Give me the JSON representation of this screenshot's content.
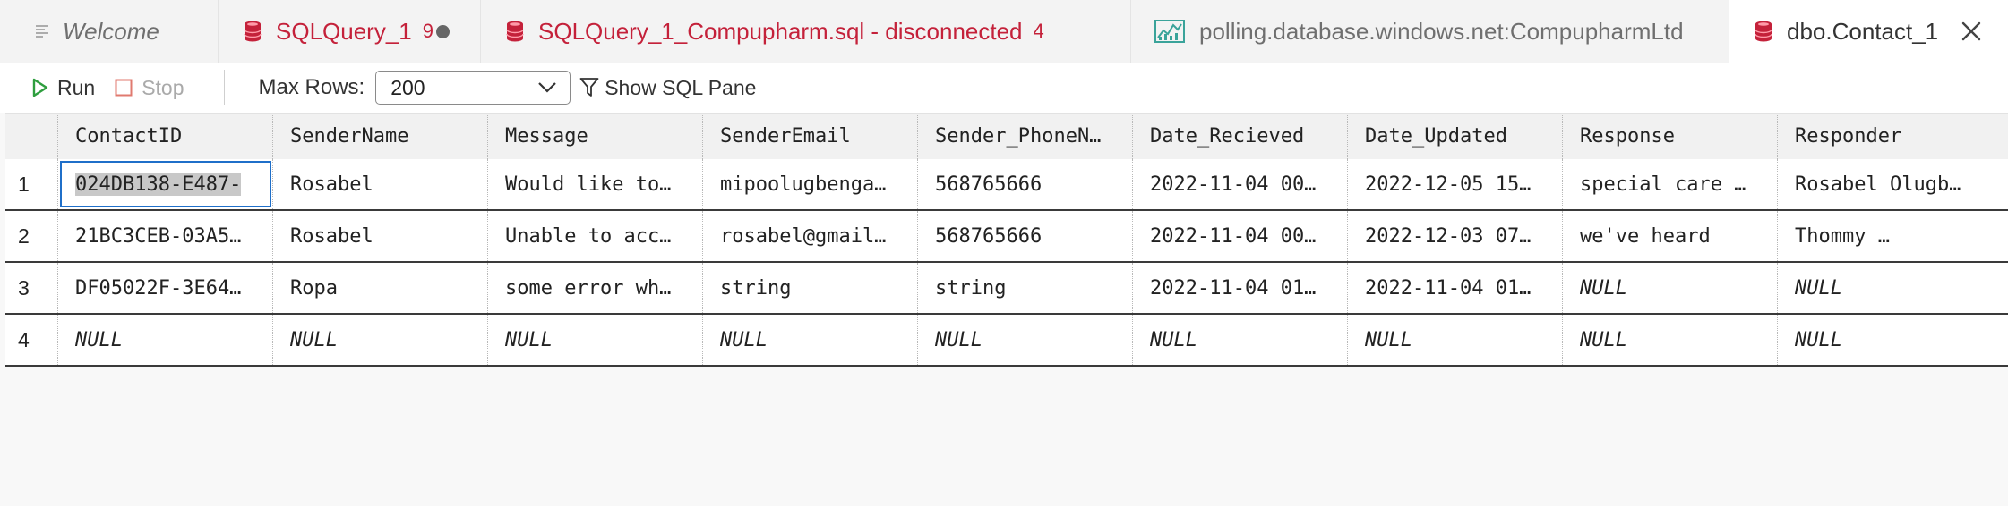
{
  "tabs": [
    {
      "label": "Welcome",
      "icon": "list-icon"
    },
    {
      "label": "SQLQuery_1",
      "badge": "9",
      "icon": "database-icon",
      "dirty": true
    },
    {
      "label": "SQLQuery_1_Compupharm.sql - disconnected",
      "badge": "4",
      "icon": "database-icon"
    },
    {
      "label": "polling.database.windows.net:CompupharmLtd",
      "icon": "dashboard-icon"
    },
    {
      "label": "dbo.Contact_1",
      "icon": "database-icon",
      "active": true
    }
  ],
  "toolbar": {
    "run_label": "Run",
    "stop_label": "Stop",
    "max_rows_label": "Max Rows:",
    "max_rows_value": "200",
    "show_sql_pane_label": "Show SQL Pane"
  },
  "grid": {
    "columns": [
      "ContactID",
      "SenderName",
      "Message",
      "SenderEmail",
      "Sender_PhoneN…",
      "Date_Recieved",
      "Date_Updated",
      "Response",
      "Responder"
    ],
    "rows": [
      {
        "num": "1",
        "cells": [
          "024DB138-E487-",
          "Rosabel",
          "Would like to…",
          "mipoolugbenga…",
          "568765666",
          "2022-11-04 00…",
          "2022-12-05 15…",
          "special care …",
          "Rosabel Olugb…"
        ]
      },
      {
        "num": "2",
        "cells": [
          "21BC3CEB-03A5…",
          "Rosabel",
          "Unable to acc…",
          "rosabel@gmail…",
          "568765666",
          "2022-11-04 00…",
          "2022-12-03 07…",
          "we've heard",
          "Thommy      …"
        ]
      },
      {
        "num": "3",
        "cells": [
          "DF05022F-3E64…",
          "Ropa",
          "some error wh…",
          "string",
          "string",
          "2022-11-04 01…",
          "2022-11-04 01…",
          "NULL",
          "NULL"
        ]
      },
      {
        "num": "4",
        "cells": [
          "NULL",
          "NULL",
          "NULL",
          "NULL",
          "NULL",
          "NULL",
          "NULL",
          "NULL",
          "NULL"
        ]
      }
    ]
  },
  "colors": {
    "accent": "#1f6fc9",
    "tab_error": "#c4213a",
    "run_green": "#2e9e3e",
    "stop_red": "#e07a6f",
    "dashboard_teal": "#3aa39a"
  }
}
